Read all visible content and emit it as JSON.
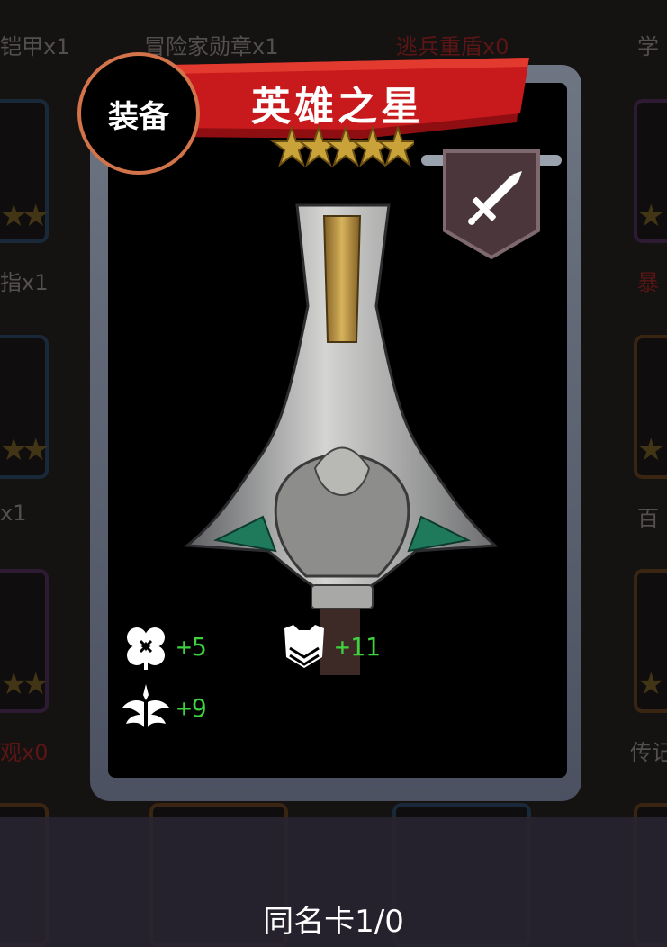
{
  "background": {
    "items": [
      {
        "label": "铠甲x1",
        "color": "gray"
      },
      {
        "label": "冒险家勋章x1",
        "color": "gray"
      },
      {
        "label": "逃兵重盾x0",
        "color": "red"
      },
      {
        "label": "学",
        "color": "gray"
      },
      {
        "label": "指x1",
        "color": "gray"
      },
      {
        "label": "暴",
        "color": "red"
      },
      {
        "label": "x1",
        "color": "gray"
      },
      {
        "label": "百",
        "color": "gray"
      },
      {
        "label": "观x0",
        "color": "red"
      },
      {
        "label": "传记",
        "color": "gray"
      }
    ]
  },
  "card": {
    "type_label": "装备",
    "name": "英雄之星",
    "rarity_stars": 5,
    "slot_icon": "sword-icon",
    "stats": [
      {
        "icon": "clover-icon",
        "value": "+5"
      },
      {
        "icon": "armor-icon",
        "value": "+11"
      },
      {
        "icon": "wing-icon",
        "value": "+9"
      }
    ]
  },
  "footer": {
    "duplicate_text": "同名卡1/0"
  },
  "colors": {
    "banner_red": "#c8191c",
    "stat_green": "#3ed23e",
    "circle_border": "#d2734a",
    "star_gold": "#c9a33a"
  }
}
